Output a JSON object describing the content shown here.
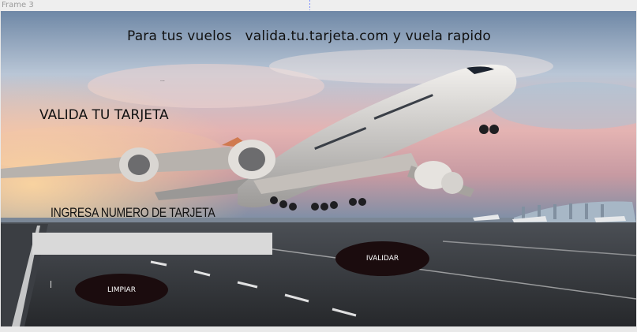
{
  "canvas": {
    "frame_label": "Frame 3"
  },
  "header": {
    "tagline": "Para tus vuelos   valida.tu.tarjeta.com y vuela rapido",
    "decor_dots": "..."
  },
  "main": {
    "heading": "VALIDA TU TARJETA",
    "input_label": "INGRESA NUMERO DE TARJETA",
    "card_input_value": "",
    "card_input_placeholder": ""
  },
  "actions": {
    "validate_label": "IVALIDAR",
    "clear_label": "LIMPIAR"
  },
  "colors": {
    "button_bg": "#1b0c0e",
    "input_bg": "#d9d9d9",
    "text": "#111111"
  },
  "background": {
    "subject": "airplane-takeoff-runway-photo"
  }
}
